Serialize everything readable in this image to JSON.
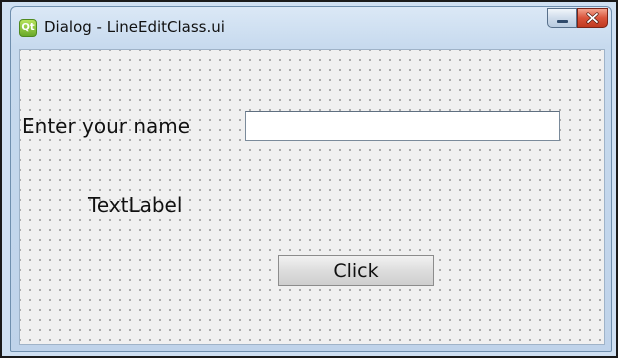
{
  "window": {
    "title": "Dialog - LineEditClass.ui",
    "app_icon_glyph": "Qt",
    "app_icon": "qt-logo-icon",
    "controls": {
      "minimize_icon": "minimize-icon",
      "close_icon": "close-icon",
      "close_color": "#c94026"
    }
  },
  "form": {
    "name_label": "Enter your name",
    "name_input": {
      "value": "",
      "placeholder": ""
    },
    "text_label": "TextLabel",
    "click_button_label": "Click"
  },
  "colors": {
    "form_background": "#f0f0f0",
    "grid_dot": "#8a8a8a",
    "window_frame": "#c7daee"
  }
}
